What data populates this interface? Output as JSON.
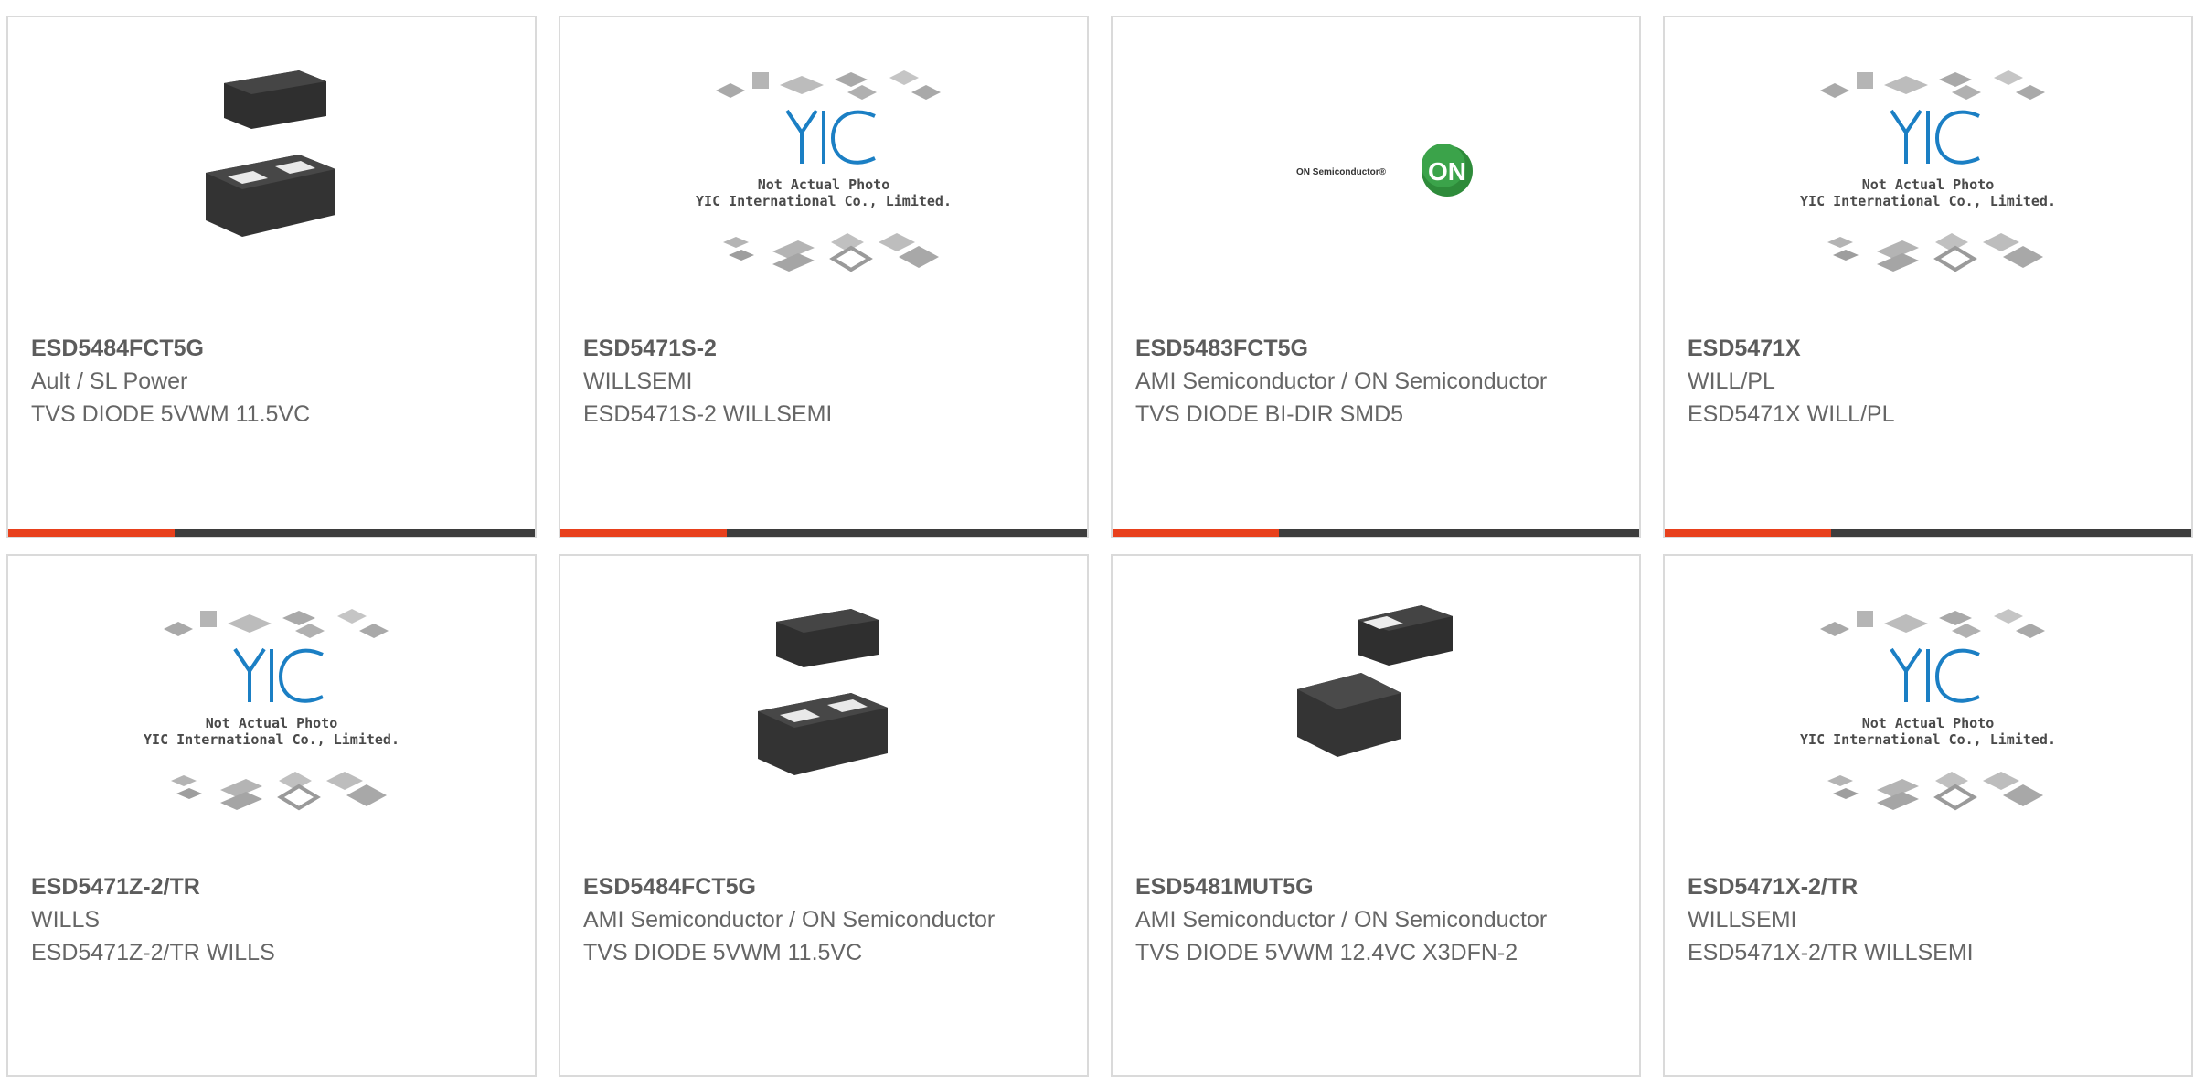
{
  "colors": {
    "accent": "#e8401c",
    "bar": "#3d3d3d",
    "border": "#dadada",
    "text": "#666666",
    "yic_blue": "#1b7fc4",
    "on_green": "#2e8b3a"
  },
  "products": [
    {
      "part": "ESD5484FCT5G",
      "mfr": "Ault / SL Power",
      "desc": "TVS DIODE 5VWM 11.5VC",
      "image": "package-dual-chip",
      "caption1": "",
      "caption2": "",
      "logo_text": "",
      "logo_badge": ""
    },
    {
      "part": "ESD5471S-2",
      "mfr": "WILLSEMI",
      "desc": "ESD5471S-2 WILLSEMI",
      "image": "yic-placeholder",
      "caption1": "Not Actual Photo",
      "caption2": "YIC International Co., Limited.",
      "logo_text": "",
      "logo_badge": ""
    },
    {
      "part": "ESD5483FCT5G",
      "mfr": "AMI Semiconductor / ON Semiconductor",
      "desc": "TVS DIODE BI-DIR SMD5",
      "image": "on-semi-logo",
      "caption1": "",
      "caption2": "",
      "logo_text": "ON Semiconductor®",
      "logo_badge": "ON"
    },
    {
      "part": "ESD5471X",
      "mfr": "WILL/PL",
      "desc": "ESD5471X WILL/PL",
      "image": "yic-placeholder",
      "caption1": "Not Actual Photo",
      "caption2": "YIC International Co., Limited.",
      "logo_text": "",
      "logo_badge": ""
    },
    {
      "part": "ESD5471Z-2/TR",
      "mfr": "WILLS",
      "desc": "ESD5471Z-2/TR WILLS",
      "image": "yic-placeholder",
      "caption1": "Not Actual Photo",
      "caption2": "YIC International Co., Limited.",
      "logo_text": "",
      "logo_badge": ""
    },
    {
      "part": "ESD5484FCT5G",
      "mfr": "AMI Semiconductor / ON Semiconductor",
      "desc": "TVS DIODE 5VWM 11.5VC",
      "image": "package-dual-chip",
      "caption1": "",
      "caption2": "",
      "logo_text": "",
      "logo_badge": ""
    },
    {
      "part": "ESD5481MUT5G",
      "mfr": "AMI Semiconductor / ON Semiconductor",
      "desc": "TVS DIODE 5VWM 12.4VC X3DFN-2",
      "image": "package-two-chips",
      "caption1": "",
      "caption2": "",
      "logo_text": "",
      "logo_badge": ""
    },
    {
      "part": "ESD5471X-2/TR",
      "mfr": "WILLSEMI",
      "desc": "ESD5471X-2/TR WILLSEMI",
      "image": "yic-placeholder",
      "caption1": "Not Actual Photo",
      "caption2": "YIC International Co., Limited.",
      "logo_text": "",
      "logo_badge": ""
    }
  ]
}
